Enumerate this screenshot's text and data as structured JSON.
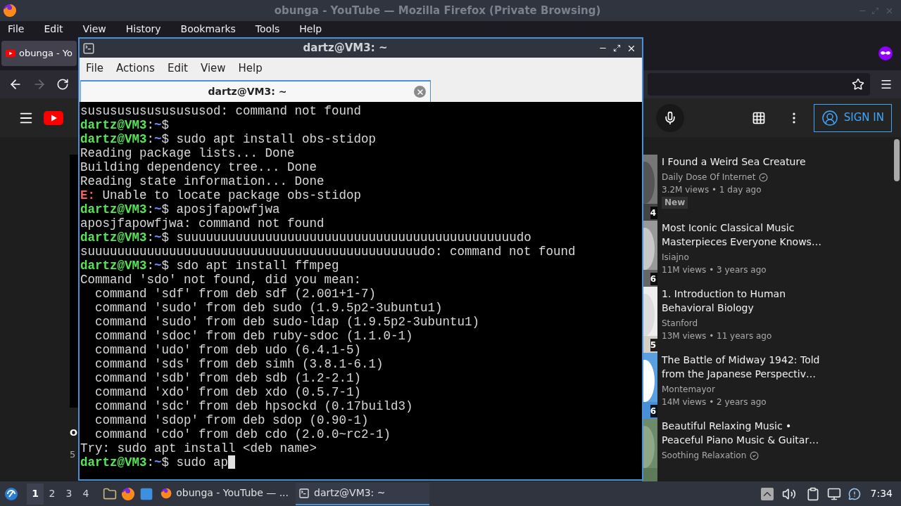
{
  "browser": {
    "title": "obunga - YouTube — Mozilla Firefox (Private Browsing)",
    "menu": [
      "File",
      "Edit",
      "View",
      "History",
      "Bookmarks",
      "Tools",
      "Help"
    ],
    "tabs": [
      {
        "label": "obunga - Yo",
        "selected": true
      }
    ],
    "forward_disabled": true
  },
  "youtube": {
    "sign_in": "SIGN IN",
    "fragment_title": "O",
    "fragment_meta": "5",
    "videos": [
      {
        "title_lines": [
          "I Found a Weird Sea Creature"
        ],
        "channel": "Daily Dose Of Internet",
        "verified": true,
        "views": "3.2M views • 1 day ago",
        "badge": "New",
        "duration": "4"
      },
      {
        "title_lines": [
          "Most Iconic Classical Music",
          "Masterpieces Everyone Knows…"
        ],
        "channel": "Isiajno",
        "verified": false,
        "views": "11M views • 3 years ago",
        "duration": "6"
      },
      {
        "title_lines": [
          "1. Introduction to Human",
          "Behavioral Biology"
        ],
        "channel": "Stanford",
        "verified": false,
        "views": "13M views • 11 years ago",
        "duration": "5"
      },
      {
        "title_lines": [
          "The Battle of Midway 1942: Told",
          "from the Japanese Perspectiv…"
        ],
        "channel": "Montemayor",
        "verified": false,
        "views": "14M views • 2 years ago",
        "duration": "6"
      },
      {
        "title_lines": [
          "Beautiful Relaxing Music •",
          "Peaceful Piano Music & Guitar…"
        ],
        "channel": "Soothing Relaxation",
        "verified": true
      }
    ]
  },
  "terminal": {
    "title": "dartz@VM3: ~",
    "menu": [
      "File",
      "Actions",
      "Edit",
      "View",
      "Help"
    ],
    "tab": "dartz@VM3: ~",
    "lines": [
      {
        "kind": "output",
        "text": "sususususususususod: command not found"
      },
      {
        "kind": "prompt",
        "host": "dartz@VM3",
        "sep": ":",
        "path": "~",
        "rest": "$"
      },
      {
        "kind": "prompt",
        "host": "dartz@VM3",
        "sep": ":",
        "path": "~",
        "rest": "$ sudo apt install obs-stidop"
      },
      {
        "kind": "output",
        "text": "Reading package lists... Done"
      },
      {
        "kind": "output",
        "text": "Building dependency tree... Done"
      },
      {
        "kind": "output",
        "text": "Reading state information... Done"
      },
      {
        "kind": "error",
        "tag": "E:",
        "text": " Unable to locate package obs-stidop"
      },
      {
        "kind": "prompt",
        "host": "dartz@VM3",
        "sep": ":",
        "path": "~",
        "rest": "$ aposjfapowfjwa"
      },
      {
        "kind": "output",
        "text": "aposjfapowfjwa: command not found"
      },
      {
        "kind": "prompt",
        "host": "dartz@VM3",
        "sep": ":",
        "path": "~",
        "rest": "$ suuuuuuuuuuuuuuuuuuuuuuuuuuuuuuuuuuuuuuuuuuuuudo"
      },
      {
        "kind": "output",
        "text": "suuuuuuuuuuuuuuuuuuuuuuuuuuuuuuuuuuuuuuuuuuuuudo: command not found"
      },
      {
        "kind": "prompt",
        "host": "dartz@VM3",
        "sep": ":",
        "path": "~",
        "rest": "$ sdo apt install ffmpeg"
      },
      {
        "kind": "output",
        "text": "Command 'sdo' not found, did you mean:"
      },
      {
        "kind": "output",
        "text": "  command 'sdf' from deb sdf (2.001+1-7)"
      },
      {
        "kind": "output",
        "text": "  command 'sudo' from deb sudo (1.9.5p2-3ubuntu1)"
      },
      {
        "kind": "output",
        "text": "  command 'sudo' from deb sudo-ldap (1.9.5p2-3ubuntu1)"
      },
      {
        "kind": "output",
        "text": "  command 'sdoc' from deb ruby-sdoc (1.1.0-1)"
      },
      {
        "kind": "output",
        "text": "  command 'udo' from deb udo (6.4.1-5)"
      },
      {
        "kind": "output",
        "text": "  command 'sds' from deb simh (3.8.1-6.1)"
      },
      {
        "kind": "output",
        "text": "  command 'sdb' from deb sdb (1.2-2.1)"
      },
      {
        "kind": "output",
        "text": "  command 'xdo' from deb xdo (0.5.7-1)"
      },
      {
        "kind": "output",
        "text": "  command 'sdc' from deb hpsockd (0.17build3)"
      },
      {
        "kind": "output",
        "text": "  command 'sdop' from deb sdop (0.90-1)"
      },
      {
        "kind": "output",
        "text": "  command 'cdo' from deb cdo (2.0.0~rc2-1)"
      },
      {
        "kind": "output",
        "text": "Try: sudo apt install <deb name>"
      },
      {
        "kind": "prompt",
        "host": "dartz@VM3",
        "sep": ":",
        "path": "~",
        "rest": "$ sudo ap",
        "cursor": true
      }
    ]
  },
  "taskbar": {
    "workspaces": [
      {
        "label": "1",
        "selected": true
      },
      {
        "label": "2",
        "selected": false
      },
      {
        "label": "3",
        "selected": false
      },
      {
        "label": "4",
        "selected": false
      }
    ],
    "tasks": [
      {
        "label": "obunga - YouTube — ...",
        "kind": "browser",
        "selected": false
      },
      {
        "label": "dartz@VM3: ~",
        "kind": "terminal",
        "selected": true
      }
    ],
    "clock": "7:34"
  }
}
